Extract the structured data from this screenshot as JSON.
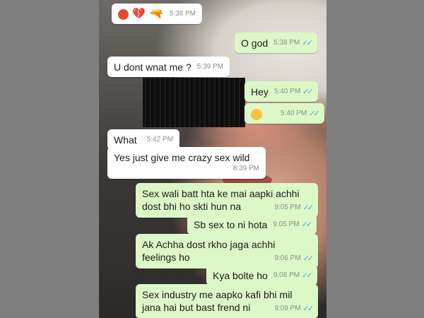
{
  "messages": [
    {
      "id": "m1",
      "dir": "in",
      "emoji": [
        "angry-face",
        "broken-heart",
        "pistol"
      ],
      "time": "5:38 PM"
    },
    {
      "id": "m2",
      "dir": "out",
      "text": "O god",
      "time": "5:38 PM",
      "read": true
    },
    {
      "id": "m3",
      "dir": "in",
      "text": "U dont wnat me ?",
      "time": "5:39 PM"
    },
    {
      "id": "m4",
      "dir": "out",
      "text": "Hey",
      "time": "5:40 PM",
      "read": true
    },
    {
      "id": "m5",
      "dir": "out",
      "emoji": [
        "thinking-face"
      ],
      "time": "5:40 PM",
      "read": true
    },
    {
      "id": "m6",
      "dir": "in",
      "text": "What",
      "time": "5:42 PM"
    },
    {
      "id": "m7",
      "dir": "in",
      "text": "Yes just give me crazy sex wild",
      "time": "8:39 PM"
    },
    {
      "id": "m8",
      "dir": "out",
      "text": "Sex wali batt hta ke mai aapki achhi dost bhi ho skti hun na",
      "time": "9:05 PM",
      "read": true
    },
    {
      "id": "m9",
      "dir": "out",
      "text": "Sb sex to ni hota",
      "time": "9:05 PM",
      "read": true
    },
    {
      "id": "m10",
      "dir": "out",
      "text": "Ak Achha dost rkho jaga achhi feelings  ho",
      "time": "9:06 PM",
      "read": true
    },
    {
      "id": "m11",
      "dir": "out",
      "text": "Kya bolte ho",
      "time": "9:08 PM",
      "read": true
    },
    {
      "id": "m12",
      "dir": "out",
      "text": "Sex industry  me aapko kafi bhi mil jana hai but bast frend ni",
      "time": "9:09 PM",
      "read": true
    }
  ],
  "colors": {
    "incoming": "#ffffff",
    "outgoing": "#dcf8c6",
    "read_ticks": "#4fa9e6"
  }
}
